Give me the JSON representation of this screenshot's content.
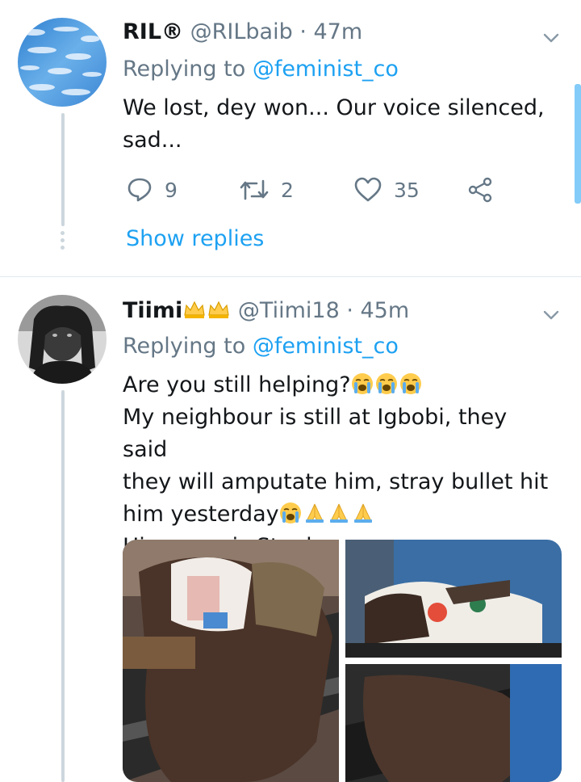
{
  "tweets": [
    {
      "display_name": "RIL®",
      "handle": "@RILbaib",
      "time": "· 47m",
      "replying_label": "Replying to",
      "replying_handle": "@feminist_co",
      "text_line1": "We lost, dey won... Our voice silenced,",
      "text_line2": "sad...",
      "replies": "9",
      "retweets": "2",
      "likes": "35",
      "show_replies": "Show replies"
    },
    {
      "display_name": "Tiimi",
      "handle": "@Tiimi18",
      "time": "· 45m",
      "replying_label": "Replying to",
      "replying_handle": "@feminist_co",
      "line1": "Are you still helping?",
      "line2": "My neighbour is still at Igbobi, they said",
      "line3": "they will amputate him, stray bullet hit",
      "line4": "him yesterday",
      "line5": "His name is Stanley"
    }
  ],
  "icons": {
    "reply": "reply-icon",
    "retweet": "retweet-icon",
    "like": "heart-icon",
    "share": "share-icon",
    "more": "chevron-down-icon",
    "crying": "loudly-crying-face-emoji",
    "pray": "folded-hands-emoji",
    "crown": "crown-icon"
  },
  "colors": {
    "accent": "#1da1f2",
    "muted": "#657786",
    "text": "#14171a",
    "divider": "#e1e8ed"
  }
}
